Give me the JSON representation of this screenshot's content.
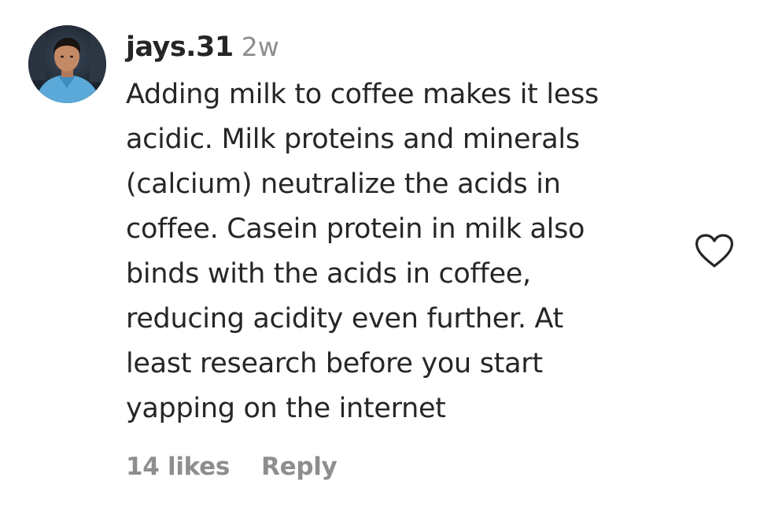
{
  "comment": {
    "avatar_icon": "user-avatar-photo",
    "username": "jays.31",
    "time_ago": "2w",
    "text_lines": [
      "Adding milk to coffee makes it less",
      "acidic. Milk proteins and minerals",
      "(calcium) neutralize the acids in",
      "coffee. Casein protein in milk also",
      "binds with the acids in coffee,",
      "reducing acidity even further. At",
      "least research before you start",
      "yapping on the internet"
    ],
    "likes_label": "14 likes",
    "reply_label": "Reply",
    "like_icon": "heart-outline-icon"
  },
  "colors": {
    "text_primary": "#262626",
    "text_secondary": "#8e8e8e",
    "background": "#ffffff"
  }
}
